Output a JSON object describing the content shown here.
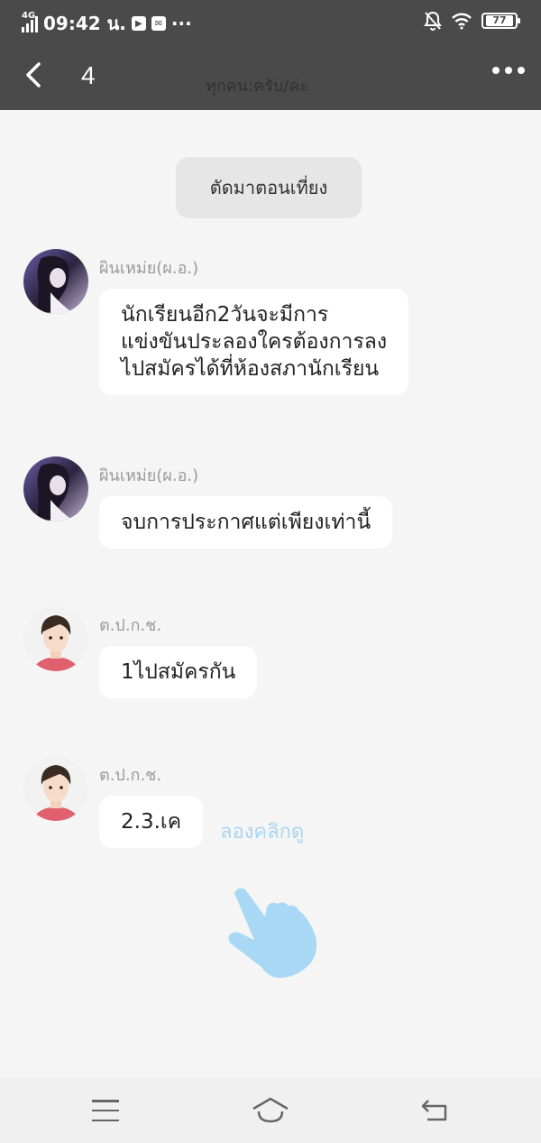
{
  "status_bar": {
    "network": "4G",
    "time": "09:42 น.",
    "more": "···",
    "battery": "77"
  },
  "header": {
    "count": "4",
    "title": "ทุกคน:ครับ/ค่ะ"
  },
  "system_message": "ตัดมาตอนเที่ยง",
  "messages": [
    {
      "sender": "ผินเหม่ย(ผ.อ.)",
      "lines": [
        "นักเรียนอีก2วันจะมีการ",
        "แข่งขันประลองใครต้องการลง",
        "ไปสมัครได้ที่ห้องสภานักเรียน"
      ]
    },
    {
      "sender": "ผินเหม่ย(ผ.อ.)",
      "lines": [
        "จบการประกาศแต่เพียงเท่านี้"
      ]
    },
    {
      "sender": "ต.ป.ก.ช.",
      "lines": [
        "1ไปสมัครกัน"
      ]
    },
    {
      "sender": "ต.ป.ก.ช.",
      "lines": [
        "2.3.เค"
      ]
    }
  ],
  "hint": "ลองคลิกดู",
  "icons": {
    "back": "chevron-left-icon",
    "more": "more-dots-icon",
    "hand": "pointing-hand-icon",
    "nav_menu": "menu-icon",
    "nav_home": "home-icon",
    "nav_back": "return-icon"
  },
  "colors": {
    "header_bg": "#4a4a4a",
    "page_bg": "#f5f5f5",
    "hint": "#a9d6f2"
  }
}
